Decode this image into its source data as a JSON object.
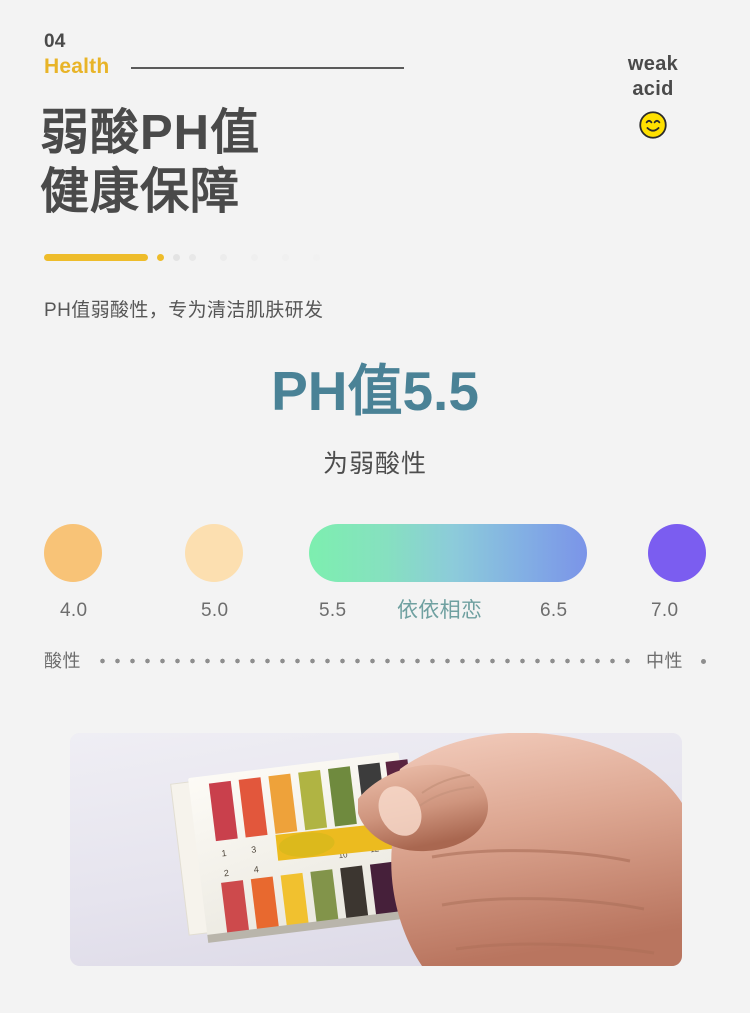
{
  "section": {
    "number": "04",
    "label": "Health"
  },
  "badge": {
    "line1": "weak",
    "line2": "acid",
    "icon": "smiley-face-icon",
    "color": "#ffe000"
  },
  "title": "弱酸PH值\n健康保障",
  "lead": "PH值弱酸性，专为清洁肌肤研发",
  "readout": {
    "headline": "PH值5.5",
    "subtitle": "为弱酸性",
    "color": "#4a8296"
  },
  "ph_scale": {
    "labels": [
      "4.0",
      "5.0",
      "5.5",
      "依依相恋",
      "6.5",
      "7.0"
    ],
    "brand_label": "依依相恋",
    "brand_color": "#6fa0a0",
    "swatches": [
      {
        "value": "4.0",
        "color": "#f8c377",
        "shape": "circle"
      },
      {
        "value": "5.0",
        "color": "#fcdfb0",
        "shape": "circle"
      },
      {
        "value": "7.0",
        "color": "#7b5df0",
        "shape": "circle"
      }
    ],
    "band": {
      "from_value": "5.5",
      "to_value": "6.5",
      "gradient_start": "#7defaf",
      "gradient_end": "#7b94e8"
    },
    "axis_start": "酸性",
    "axis_end": "中性"
  },
  "photo": {
    "alt": "hand holding ph test strips against color chart",
    "chart_numbers": [
      "1",
      "2",
      "3",
      "4"
    ],
    "strip_colors": [
      "#c9404c",
      "#e2573c",
      "#eea23a",
      "#b0b443",
      "#6f8a3e",
      "#3c3c3c",
      "#5b2440"
    ]
  },
  "accent": {
    "bar_color": "#eebc2a",
    "active_dot_color": "#eebc2a"
  }
}
